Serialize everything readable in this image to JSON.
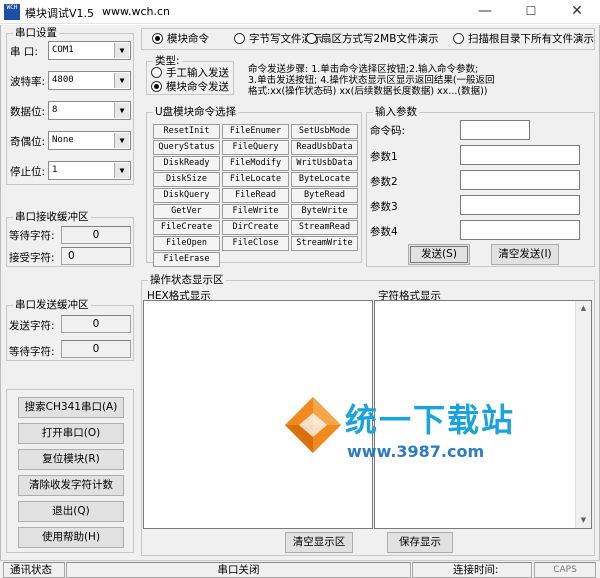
{
  "window": {
    "title": "模块调试V1.5",
    "url": "www.wch.cn",
    "icon_text": "WCH",
    "minimize": "—",
    "maximize": "☐",
    "close": "✕"
  },
  "serial_settings": {
    "title": "串口设置",
    "rows": [
      {
        "label": "串  口:",
        "value": "COM1"
      },
      {
        "label": "波特率:",
        "value": "4800"
      },
      {
        "label": "数据位:",
        "value": "8"
      },
      {
        "label": "奇偶位:",
        "value": "None"
      },
      {
        "label": "停止位:",
        "value": "1"
      }
    ]
  },
  "rx_buffer": {
    "title": "串口接收缓冲区",
    "rows": [
      {
        "label": "等待字符:",
        "value": "0"
      },
      {
        "label": "接受字符:",
        "value": "0"
      }
    ]
  },
  "tx_buffer": {
    "title": "串口发送缓冲区",
    "rows": [
      {
        "label": "发送字符:",
        "value": "0"
      },
      {
        "label": "等待字符:",
        "value": "0"
      }
    ]
  },
  "left_buttons": [
    "搜索CH341串口(A)",
    "打开串口(O)",
    "复位模块(R)",
    "清除收发字符计数",
    "退出(Q)",
    "使用帮助(H)"
  ],
  "mode_tabs": [
    {
      "label": "模块命令",
      "selected": true
    },
    {
      "label": "字节写文件演示",
      "selected": false
    },
    {
      "label": "扇区方式写2MB文件演示",
      "selected": false
    },
    {
      "label": "扫描根目录下所有文件演示",
      "selected": false
    }
  ],
  "input_type": {
    "title": "类型:",
    "options": [
      {
        "label": "手工输入发送",
        "selected": false
      },
      {
        "label": "模块命令发送",
        "selected": true
      }
    ]
  },
  "instructions": [
    "命令发送步骤: 1.单击命令选择区按钮;2.输入命令参数;",
    "3.单击发送按钮; 4.操作状态显示区显示返回结果(一般返回",
    "格式:xx(操作状态码) xx(后续数据长度数据) xx...(数据))"
  ],
  "udisk_commands": {
    "title": "U盘模块命令选择",
    "items": [
      "ResetInit",
      "FileEnumer",
      "SetUsbMode",
      "QueryStatus",
      "FileQuery",
      "ReadUsbData",
      "DiskReady",
      "FileModify",
      "WritUsbData",
      "DiskSize",
      "FileLocate",
      "ByteLocate",
      "DiskQuery",
      "FileRead",
      "ByteRead",
      "GetVer",
      "FileWrite",
      "ByteWrite",
      "FileCreate",
      "DirCreate",
      "StreamRead",
      "FileOpen",
      "FileClose",
      "StreamWrite",
      "FileErase"
    ]
  },
  "params": {
    "title": "输入参数",
    "command_code_label": "命令码:",
    "labels": [
      "参数1",
      "参数2",
      "参数3",
      "参数4"
    ],
    "send_button": "发送(S)",
    "clear_button": "清空发送(I)"
  },
  "status_area": {
    "title": "操作状态显示区",
    "hex_title": "HEX格式显示",
    "char_title": "字符格式显示",
    "clear_button": "清空显示区",
    "save_button": "保存显示"
  },
  "watermark": {
    "main": "统一下载站",
    "url": "www.3987.com"
  },
  "statusbar": {
    "comm_status": "通讯状态",
    "port_status": "串口关闭",
    "connect_time": "连接时间:",
    "caps": "CAPS"
  },
  "colors": {
    "watermark_blue": "#1aa3dd",
    "watermark_orange": "#f08a1c",
    "window_bg": "#f0f0f0"
  }
}
